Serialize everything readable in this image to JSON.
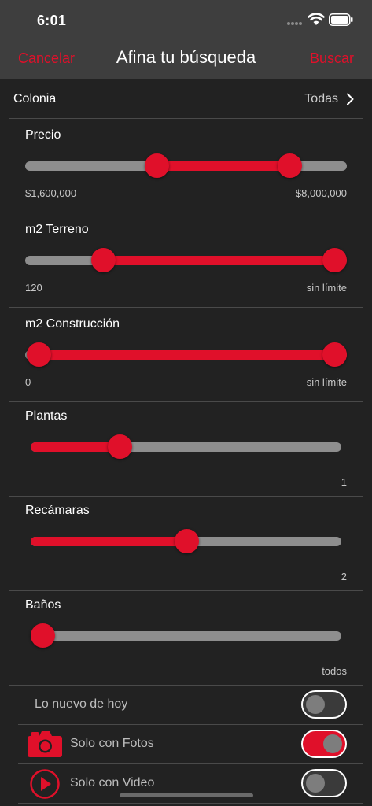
{
  "status_bar": {
    "time": "6:01"
  },
  "nav": {
    "cancel_label": "Cancelar",
    "title": "Afina tu búsqueda",
    "search_label": "Buscar"
  },
  "colonia": {
    "label": "Colonia",
    "value": "Todas"
  },
  "filters": {
    "precio": {
      "title": "Precio",
      "min_label": "$1,600,000",
      "max_label": "$8,000,000",
      "low": 0.4,
      "high": 0.85
    },
    "terreno": {
      "title": "m2 Terreno",
      "min_label": "120",
      "max_label": "sin límite",
      "low": 0.22,
      "high": 1.0
    },
    "construccion": {
      "title": "m2 Construcción",
      "min_label": "0",
      "max_label": "sin límite",
      "low": 0.0,
      "high": 1.0
    },
    "plantas": {
      "title": "Plantas",
      "value_label": "1",
      "level": 0.27
    },
    "recamaras": {
      "title": "Recámaras",
      "value_label": "2",
      "level": 0.5
    },
    "banos": {
      "title": "Baños",
      "value_label": "todos",
      "level": 0.0
    }
  },
  "toggles": {
    "nuevo": {
      "label": "Lo nuevo de hoy",
      "on": false
    },
    "fotos": {
      "label": "Solo con Fotos",
      "on": true
    },
    "video": {
      "label": "Solo con Video",
      "on": false
    }
  },
  "colors": {
    "accent": "#e0102a",
    "track": "#8e8e8e",
    "background": "#222222",
    "header": "#3e3e3e"
  }
}
